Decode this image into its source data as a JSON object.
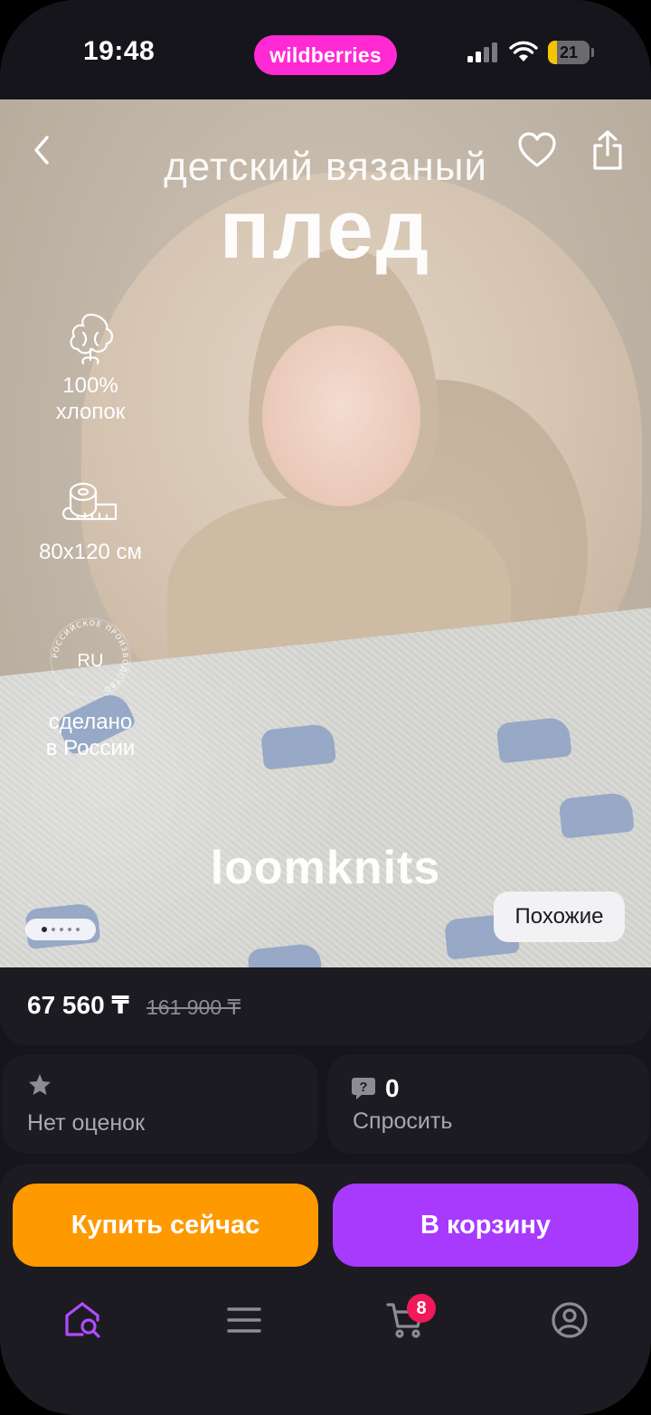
{
  "status_bar": {
    "time": "19:48",
    "app_badge": "wildberries",
    "battery_level": "21",
    "battery_fraction": 0.21
  },
  "gallery": {
    "title_line_1": "детский вязаный",
    "title_line_2": "плед",
    "features": [
      {
        "icon": "cotton-icon",
        "text_1": "100%",
        "text_2": "хлопок"
      },
      {
        "icon": "measuring-tape-icon",
        "text_1": "80х120 см",
        "text_2": ""
      },
      {
        "icon": "made-in-russia-seal-icon",
        "seal_code": "RU",
        "seal_ring_text": "РОССИЙСКОЕ ПРОИЗВОДСТВО",
        "text_1": "сделано",
        "text_2": "в России"
      }
    ],
    "brand": "loomknits",
    "similar_label": "Похожие",
    "page_count": 5,
    "current_page": 1
  },
  "price": {
    "current": "67 560 ₸",
    "old": "161 900 ₸"
  },
  "rating": {
    "icon": "star-icon",
    "label": "Нет оценок"
  },
  "questions": {
    "icon": "question-bubble-icon",
    "count": "0",
    "label": "Спросить"
  },
  "actions": {
    "buy_now": "Купить сейчас",
    "add_to_cart": "В корзину"
  },
  "bottom_nav": {
    "items": [
      "home-search-icon",
      "catalog-menu-icon",
      "cart-icon",
      "profile-icon"
    ],
    "cart_count": "8"
  },
  "colors": {
    "brand_pink": "#ff2ad4",
    "buy_orange": "#ff9900",
    "cart_purple": "#a73afd",
    "badge_red": "#f0195a",
    "background": "#16151b"
  }
}
